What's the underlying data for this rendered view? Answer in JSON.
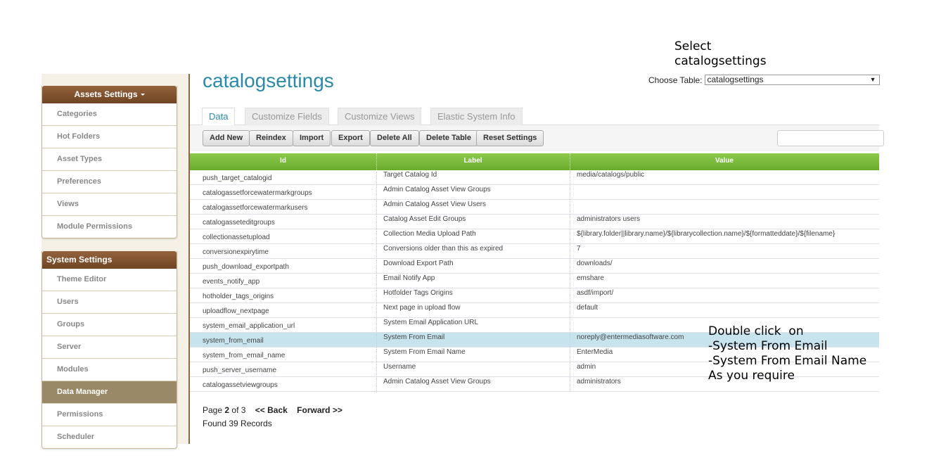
{
  "sidebar": {
    "assets": {
      "title": "Assets Settings",
      "items": [
        "Categories",
        "Hot Folders",
        "Asset Types",
        "Preferences",
        "Views",
        "Module Permissions"
      ]
    },
    "system": {
      "title": "System Settings",
      "items": [
        "Theme Editor",
        "Users",
        "Groups",
        "Server",
        "Modules",
        "Data Manager",
        "Permissions",
        "Scheduler"
      ],
      "active": "Data Manager"
    }
  },
  "annotations": {
    "top": "Select\ncatalogsettings",
    "bottom": "Double click  on\n-System From Email\n-System From Email Name\nAs you require"
  },
  "header": {
    "title": "catalogsettings",
    "choose_label": "Choose Table:",
    "choose_value": "catalogsettings"
  },
  "tabs": [
    "Data",
    "Customize Fields",
    "Customize Views",
    "Elastic System Info"
  ],
  "toolbar": {
    "add": "Add New",
    "reindex": "Reindex",
    "import": "Import",
    "export": "Export",
    "delete_all": "Delete All",
    "delete_table": "Delete Table",
    "reset": "Reset Settings"
  },
  "table": {
    "columns": [
      "Id",
      "Label",
      "Value"
    ],
    "rows": [
      {
        "id": "push_target_catalogid",
        "label": "Target Catalog Id",
        "value": "media/catalogs/public"
      },
      {
        "id": "catalogassetforcewatermarkgroups",
        "label": "Admin Catalog Asset View Groups",
        "value": ""
      },
      {
        "id": "catalogassetforcewatermarkusers",
        "label": "Admin Catalog Asset View Users",
        "value": ""
      },
      {
        "id": "catalogasseteditgroups",
        "label": "Catalog Asset Edit Groups",
        "value": "administrators users"
      },
      {
        "id": "collectionassetupload",
        "label": "Collection Media Upload Path",
        "value": "${library.folder||library.name}/${librarycollection.name}/${formatteddate}/${filename}"
      },
      {
        "id": "conversionexpirytime",
        "label": "Conversions older than this as expired",
        "value": "7"
      },
      {
        "id": "push_download_exportpath",
        "label": "Download Export Path",
        "value": "downloads/"
      },
      {
        "id": "events_notify_app",
        "label": "Email Notify App",
        "value": "emshare"
      },
      {
        "id": "hotholder_tags_origins",
        "label": "Hotfolder Tags Origins",
        "value": "asdf/import/"
      },
      {
        "id": "uploadflow_nextpage",
        "label": "Next page in upload flow",
        "value": "default"
      },
      {
        "id": "system_email_application_url",
        "label": "System Email Application URL",
        "value": ""
      },
      {
        "id": "system_from_email",
        "label": "System From Email",
        "value": "noreply@entermediasoftware.com",
        "selected": true
      },
      {
        "id": "system_from_email_name",
        "label": "System From Email Name",
        "value": "EnterMedia"
      },
      {
        "id": "push_server_username",
        "label": "Username",
        "value": "admin"
      },
      {
        "id": "catalogassetviewgroups",
        "label": "Admin Catalog Asset View Groups",
        "value": "administrators"
      }
    ]
  },
  "pager": {
    "page_label": "Page",
    "current": "2",
    "of_label": "of 3",
    "back": "<< Back",
    "forward": "Forward >>",
    "found": "Found 39 Records"
  }
}
